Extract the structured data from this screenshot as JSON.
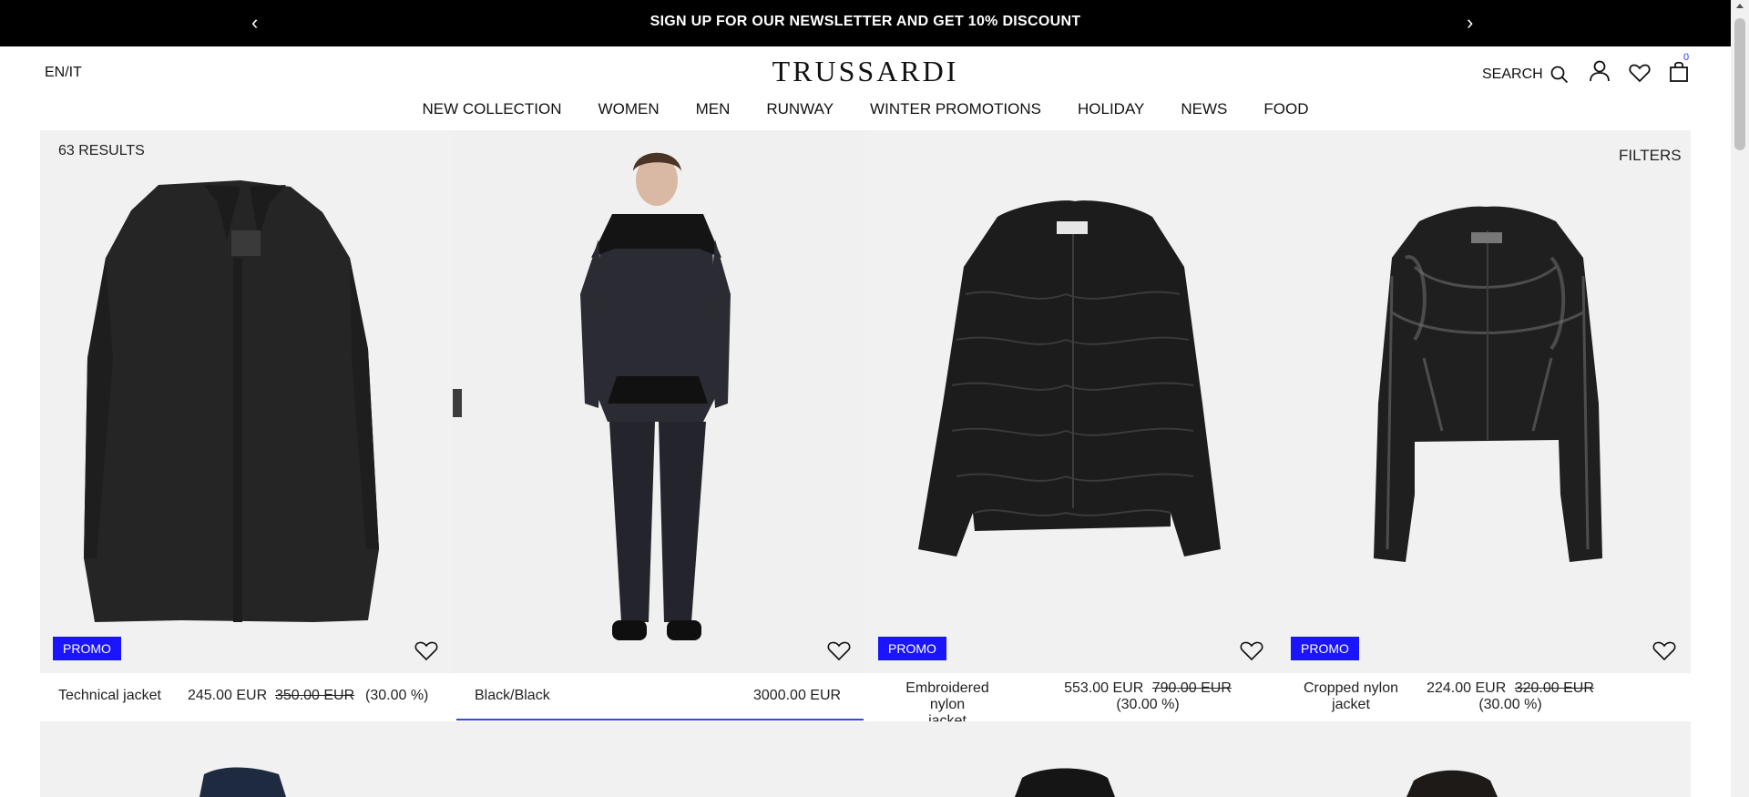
{
  "banner": {
    "message": "SIGN UP FOR OUR NEWSLETTER AND GET 10% DISCOUNT",
    "prev_icon": "chevron-left-icon",
    "next_icon": "chevron-right-icon"
  },
  "header": {
    "language": "EN/IT",
    "logo": "TRUSSARDI",
    "search_label": "SEARCH",
    "bag_count": "0"
  },
  "nav": [
    {
      "label": "NEW COLLECTION"
    },
    {
      "label": "WOMEN"
    },
    {
      "label": "MEN"
    },
    {
      "label": "RUNWAY"
    },
    {
      "label": "WINTER PROMOTIONS"
    },
    {
      "label": "HOLIDAY"
    },
    {
      "label": "NEWS"
    },
    {
      "label": "FOOD"
    }
  ],
  "listing": {
    "results": "63 RESULTS",
    "filters": "FILTERS"
  },
  "products": [
    {
      "name": "Technical jacket",
      "price": "245.00 EUR",
      "old_price": "350.00 EUR",
      "discount": "(30.00 %)",
      "badge": "PROMO"
    },
    {
      "name": "Black/Black",
      "price": "3000.00 EUR"
    },
    {
      "name_line1": "Embroidered nylon",
      "name_line2": "jacket",
      "price": "553.00 EUR",
      "old_price": "790.00 EUR",
      "discount": "(30.00 %)",
      "badge": "PROMO"
    },
    {
      "name_line1": "Cropped nylon",
      "name_line2": "jacket",
      "price": "224.00 EUR",
      "old_price": "320.00 EUR",
      "discount": "(30.00 %)",
      "badge": "PROMO"
    }
  ],
  "colors": {
    "promo": "#1a14ff",
    "tile_bg": "#f1f1f1",
    "selected_underline": "#3a4bd0"
  }
}
